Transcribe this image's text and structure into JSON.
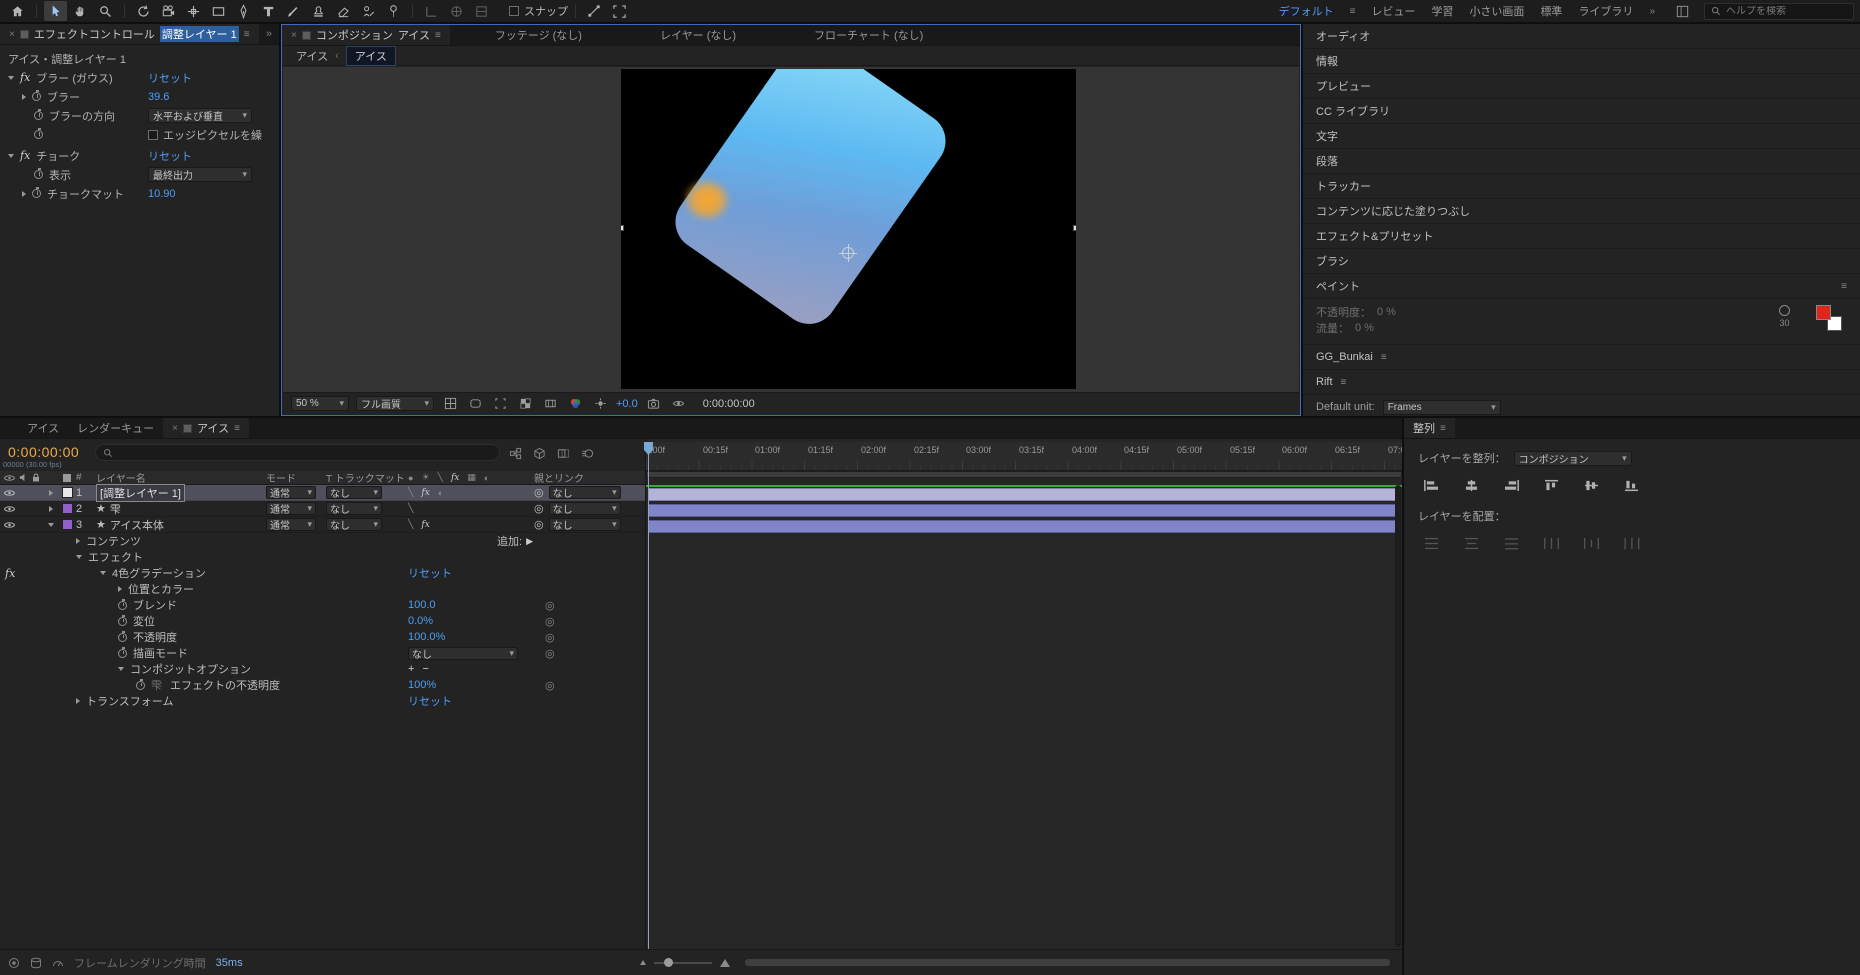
{
  "colors": {
    "accent_blue": "#4e9df5",
    "panel_focus_border": "#3a6fb4",
    "time_orange": "#edaa4a",
    "cache_green": "#37a93c",
    "adjustment_bar": "#b4b4d8",
    "shape_bar": "#8084c8",
    "label_purple": "#9061c9",
    "label_gray": "#e8e8e8",
    "paint_foreground": "#e1251b",
    "paint_background": "#ffffff",
    "viewport_bg": "#000000",
    "shape_gradient": [
      "#8fdef8",
      "#5db9f2",
      "#9d9fc0"
    ],
    "blob_orange": "#f9a72b"
  },
  "glyphs": {
    "menu": "≡",
    "close": "×",
    "overflow": "»",
    "caret": "▾",
    "breadcrumb_sep": "‹",
    "star": "★",
    "pickwhip": "◎",
    "keyframe_circle": "◎",
    "plus": "+",
    "minus": "−",
    "quality": "╲",
    "fx": "fx",
    "sun": "☀",
    "add_arrow": "▶",
    "grid": "▦",
    "half": "◐",
    "dot": "●"
  },
  "toolbar": {
    "snap_label": "スナップ",
    "workspaces": [
      "デフォルト",
      "レビュー",
      "学習",
      "小さい画面",
      "標準",
      "ライブラリ"
    ],
    "search_placeholder": "ヘルプを検索"
  },
  "effect_controls": {
    "tab": {
      "title": "エフェクトコントロール",
      "target": "調整レイヤー 1"
    },
    "heading": "アイス・調整レイヤー 1",
    "effects": [
      {
        "name": "ブラー (ガウス)",
        "reset": "リセット",
        "props": {
          "blur": {
            "label": "ブラー",
            "value": "39.6"
          },
          "direction": {
            "label": "ブラーの方向",
            "value": "水平および垂直"
          },
          "edge": {
            "label": "エッジピクセルを繰"
          }
        }
      },
      {
        "name": "チョーク",
        "reset": "リセット",
        "props": {
          "view": {
            "label": "表示",
            "value": "最終出力"
          },
          "choke": {
            "label": "チョークマット",
            "value": "10.90"
          }
        }
      }
    ]
  },
  "composition": {
    "tab": {
      "title": "コンポジション",
      "target": "アイス"
    },
    "other_tabs": [
      "フッテージ (なし)",
      "レイヤー (なし)",
      "フローチャート (なし)"
    ],
    "breadcrumb": {
      "root": "アイス",
      "current": "アイス"
    },
    "footer": {
      "zoom": "50 %",
      "quality": "フル画質",
      "exposure": "+0.0",
      "time": "0:00:00:00"
    }
  },
  "sidebar": {
    "panels": [
      "オーディオ",
      "情報",
      "プレビュー",
      "CC ライブラリ",
      "文字",
      "段落",
      "トラッカー",
      "コンテンツに応じた塗りつぶし",
      "エフェクト&プリセット",
      "ブラシ"
    ],
    "paint": {
      "title": "ペイント",
      "opacity_label": "不透明度：",
      "opacity_value": "0 %",
      "flow_label": "流量：",
      "flow_value": "0 %",
      "brush_size": "30"
    },
    "scripts": [
      "GG_Bunkai",
      "Rift"
    ],
    "unit": {
      "label": "Default unit:",
      "value": "Frames"
    }
  },
  "align": {
    "title": "整列",
    "align_label": "レイヤーを整列：",
    "align_target": "コンポジション",
    "distribute_label": "レイヤーを配置："
  },
  "timeline": {
    "tabs": [
      "アイス",
      "レンダーキュー"
    ],
    "active_tab": "アイス",
    "time": "0:00:00:00",
    "frame_info": "00000 (30.00 fps)",
    "headers": {
      "num": "#",
      "name": "レイヤー名",
      "mode": "モード",
      "matte": "T トラックマット",
      "parent": "親とリンク"
    },
    "layers": [
      {
        "num": "1",
        "name": "[調整レイヤー 1]",
        "mode": "通常",
        "matte": "なし",
        "parent": "なし",
        "chip_style": "background:#e8e8e8"
      },
      {
        "num": "2",
        "name": "雫",
        "mode": "通常",
        "matte": "なし",
        "parent": "なし",
        "chip_style": "background:#9061c9"
      },
      {
        "num": "3",
        "name": "アイス本体",
        "mode": "通常",
        "matte": "なし",
        "parent": "なし",
        "chip_style": "background:#9061c9"
      }
    ],
    "props": {
      "contents": "コンテンツ",
      "add_label": "追加:",
      "effects": "エフェクト",
      "gradient": "4色グラデーション",
      "reset": "リセット",
      "pos_color": "位置とカラー",
      "blend": {
        "label": "ブレンド",
        "value": "100.0"
      },
      "displace": {
        "label": "変位",
        "value": "0.0%"
      },
      "opacity": {
        "label": "不透明度",
        "value": "100.0%"
      },
      "blend_mode": {
        "label": "描画モード",
        "value": "なし"
      },
      "comp_opts": "コンポジットオプション",
      "mask_ref": "雫",
      "fx_opacity": {
        "label": "エフェクトの不透明度",
        "value": "100%"
      },
      "transform": "トランスフォーム"
    },
    "ruler": [
      ":00f",
      "00:15f",
      "01:00f",
      "01:15f",
      "02:00f",
      "02:15f",
      "03:00f",
      "03:15f",
      "04:00f",
      "04:15f",
      "05:00f",
      "05:15f",
      "06:00f",
      "06:15f",
      "07:0"
    ],
    "status": {
      "label": "フレームレンダリング時間",
      "value": "35ms"
    }
  }
}
